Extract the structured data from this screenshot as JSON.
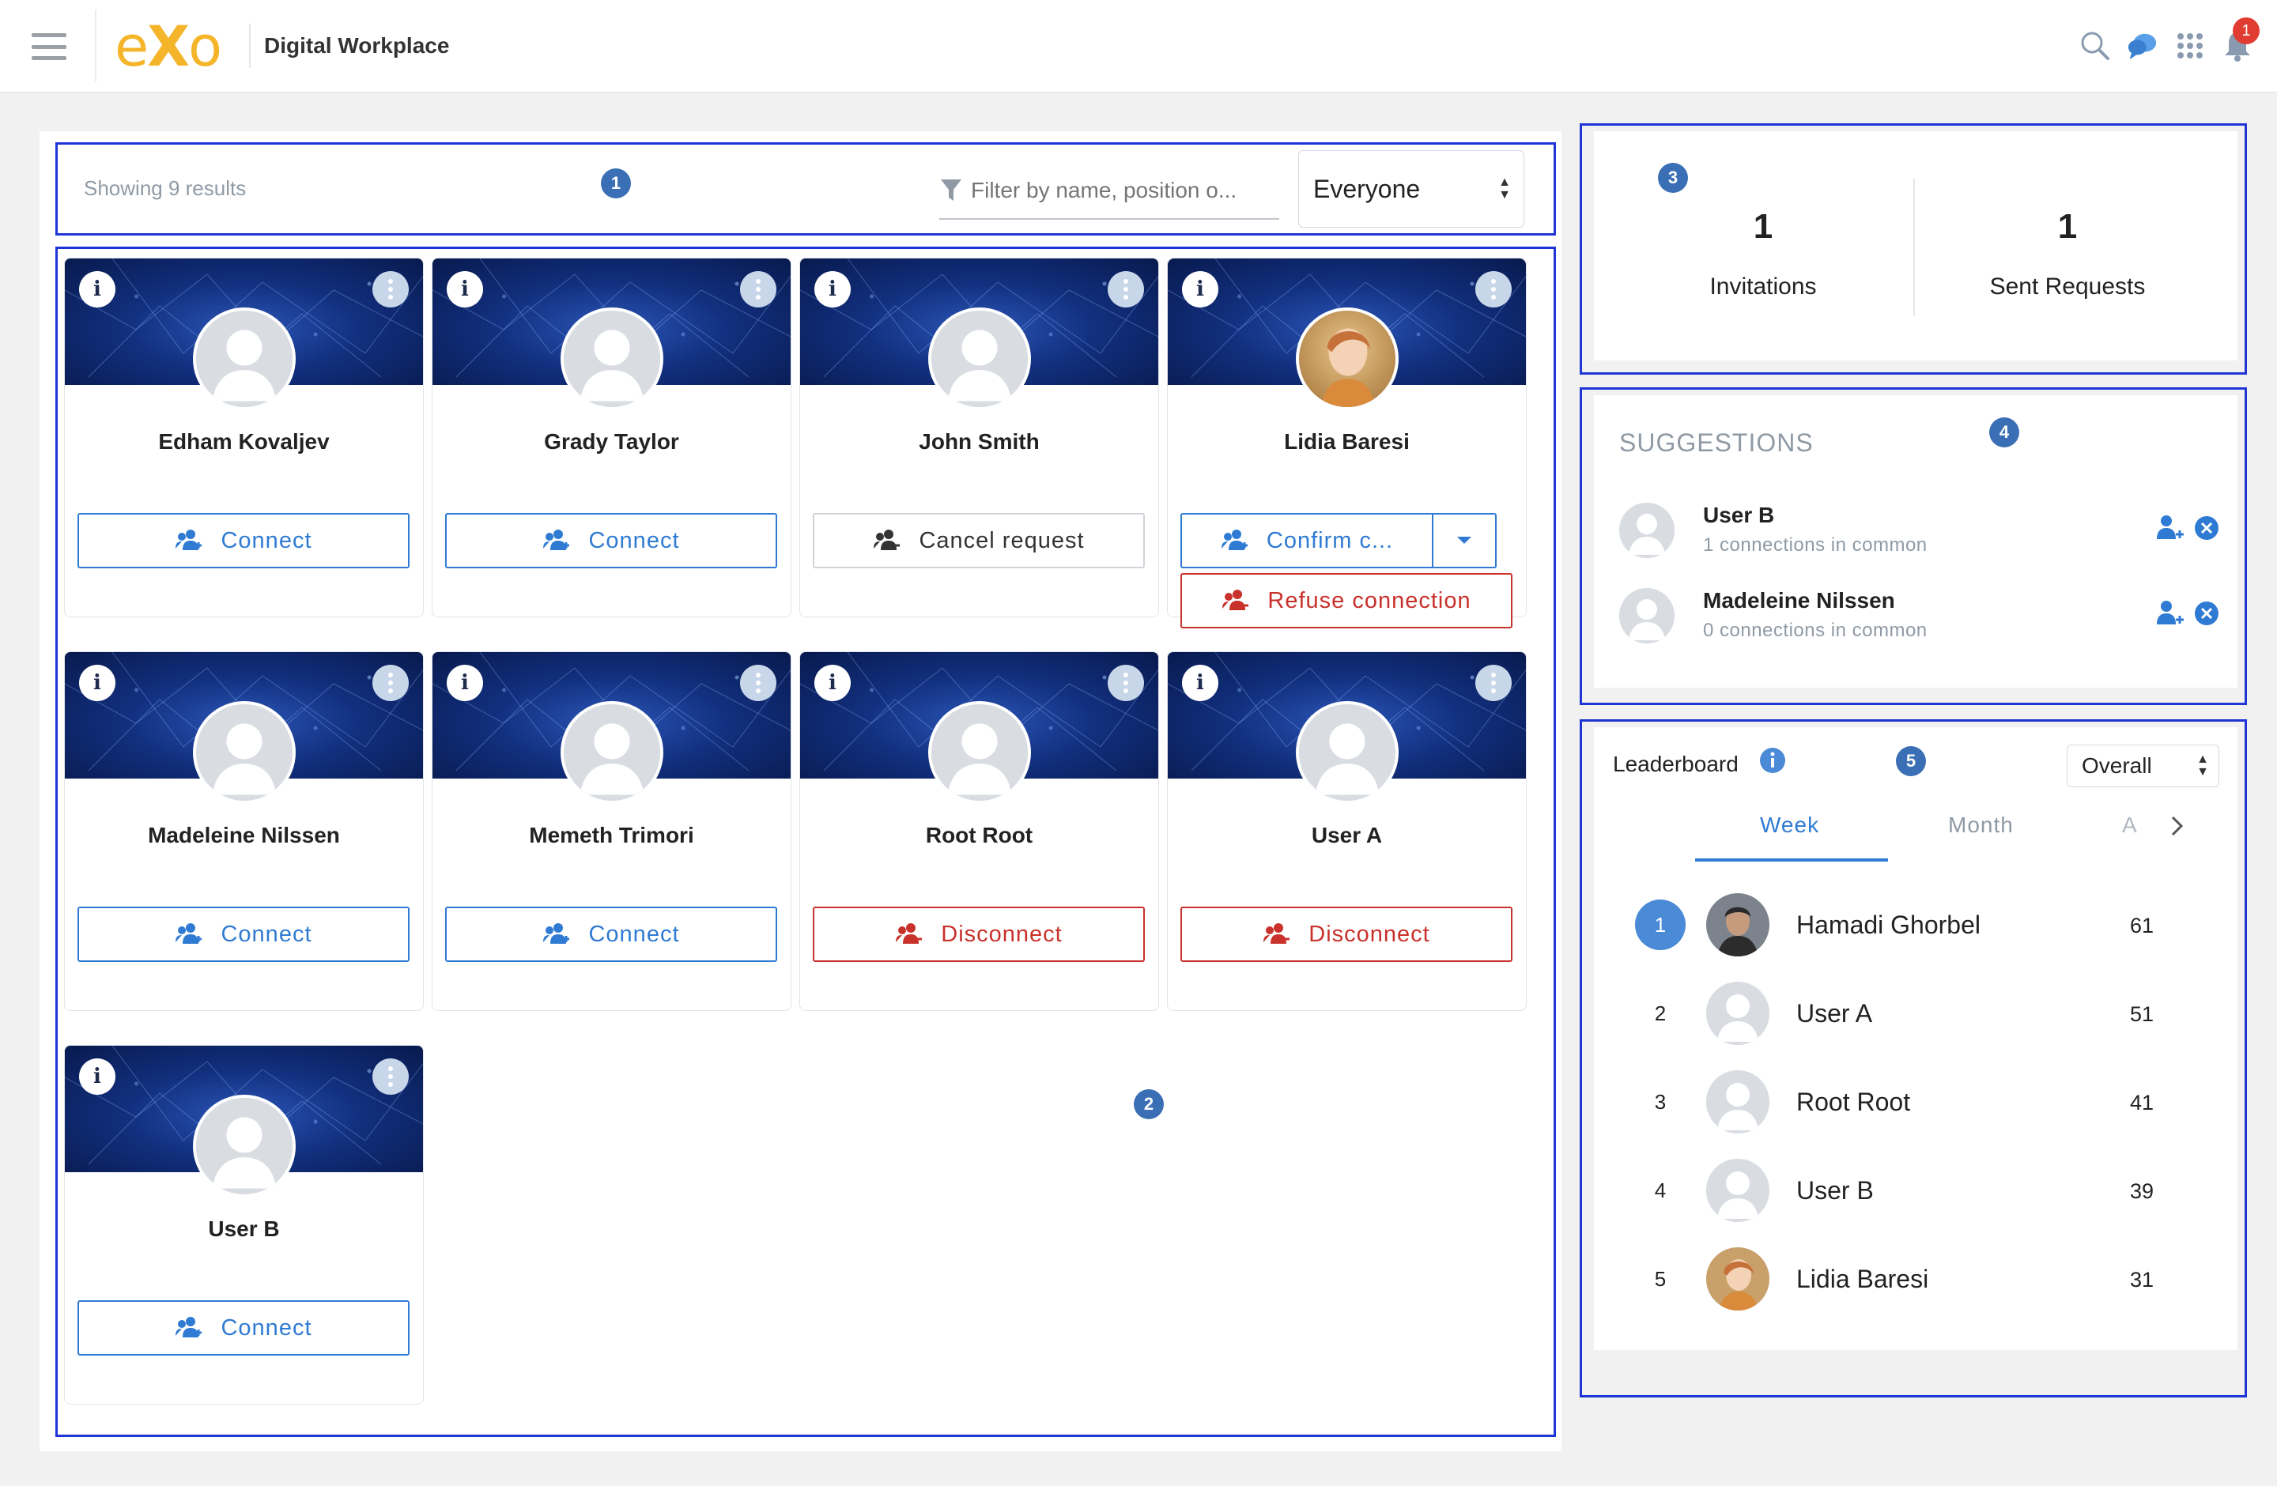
{
  "header": {
    "logo": "eXo",
    "app_title": "Digital Workplace",
    "notification_count": "1",
    "icons": [
      "search-icon",
      "chat-icon",
      "apps-grid-icon",
      "bell-icon"
    ]
  },
  "toolbar": {
    "results_text": "Showing 9 results",
    "filter_placeholder": "Filter by name, position o...",
    "filter_select_value": "Everyone"
  },
  "annotations": [
    "1",
    "2",
    "3",
    "4",
    "5"
  ],
  "cards": [
    {
      "name": "Edham Kovaljev",
      "action": "Connect"
    },
    {
      "name": "Grady Taylor",
      "action": "Connect"
    },
    {
      "name": "John Smith",
      "action": "Cancel request"
    },
    {
      "name": "Lidia Baresi",
      "action": "Confirm c...",
      "secondary_action": "Refuse connection"
    },
    {
      "name": "Madeleine Nilssen",
      "action": "Connect"
    },
    {
      "name": "Memeth Trimori",
      "action": "Connect"
    },
    {
      "name": "Root Root",
      "action": "Disconnect"
    },
    {
      "name": "User A",
      "action": "Disconnect"
    },
    {
      "name": "User B",
      "action": "Connect"
    }
  ],
  "stats": {
    "invitations_count": "1",
    "invitations_label": "Invitations",
    "sent_count": "1",
    "sent_label": "Sent Requests"
  },
  "suggestions": {
    "title": "SUGGESTIONS",
    "items": [
      {
        "name": "User B",
        "common": "1 connections in common"
      },
      {
        "name": "Madeleine Nilssen",
        "common": "0 connections in common"
      }
    ]
  },
  "leaderboard": {
    "title": "Leaderboard",
    "select_value": "Overall",
    "tabs": [
      "Week",
      "Month",
      "A"
    ],
    "active_tab": "Week",
    "rows": [
      {
        "rank": "1",
        "name": "Hamadi Ghorbel",
        "points": "61"
      },
      {
        "rank": "2",
        "name": "User A",
        "points": "51"
      },
      {
        "rank": "3",
        "name": "Root Root",
        "points": "41"
      },
      {
        "rank": "4",
        "name": "User B",
        "points": "39"
      },
      {
        "rank": "5",
        "name": "Lidia Baresi",
        "points": "31"
      }
    ]
  },
  "colors": {
    "accent_blue": "#2f7bd3",
    "danger_red": "#c9312b",
    "annotation_border": "#1f35d6",
    "logo_yellow": "#f5b52b"
  }
}
